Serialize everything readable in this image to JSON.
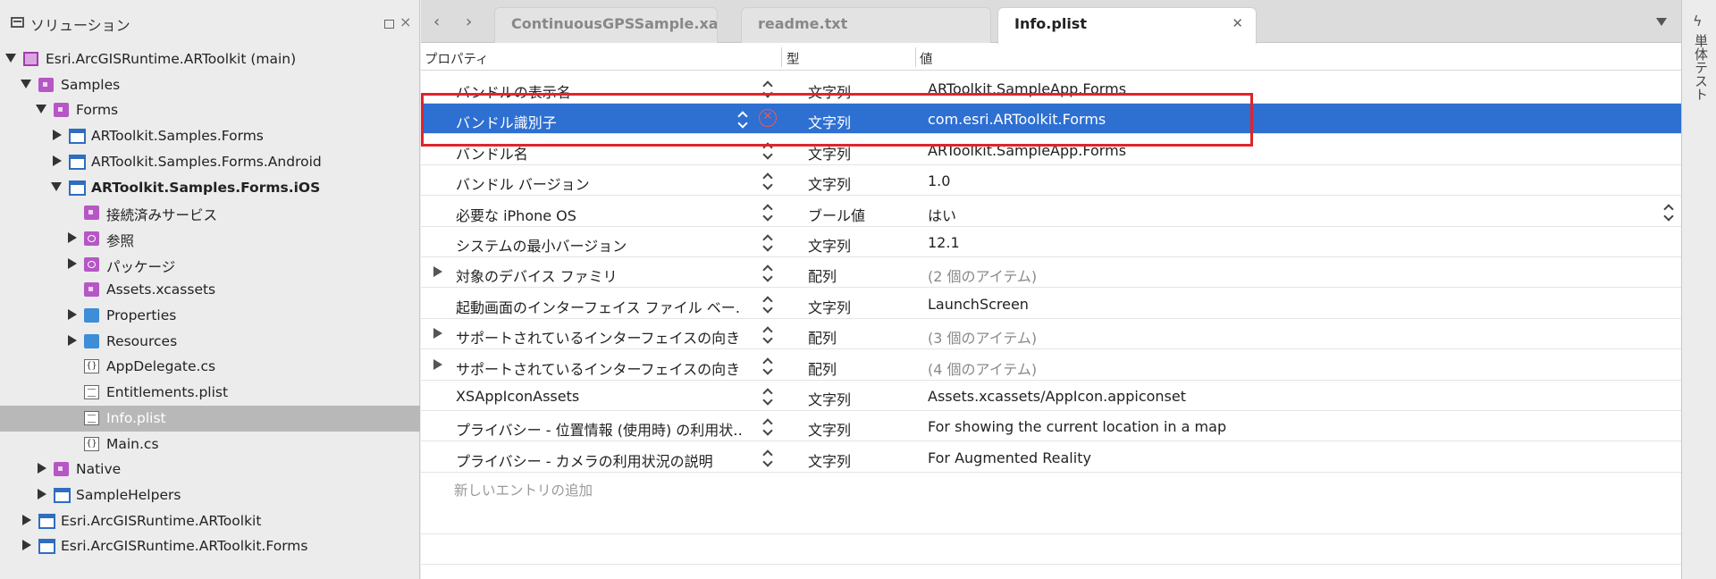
{
  "solution_pad": {
    "title": "ソリューション",
    "tree": [
      {
        "label": "Esri.ArcGISRuntime.ARToolkit (main)",
        "depth": 0,
        "arrow": "open",
        "icon": "solution-icon"
      },
      {
        "label": "Samples",
        "depth": 1,
        "arrow": "open",
        "icon": "folder-icon"
      },
      {
        "label": "Forms",
        "depth": 2,
        "arrow": "open",
        "icon": "folder-icon"
      },
      {
        "label": "ARToolkit.Samples.Forms",
        "depth": 3,
        "arrow": "closed",
        "icon": "project-icon"
      },
      {
        "label": "ARToolkit.Samples.Forms.Android",
        "depth": 3,
        "arrow": "closed",
        "icon": "project-icon"
      },
      {
        "label": "ARToolkit.Samples.Forms.iOS",
        "depth": 3,
        "arrow": "open",
        "icon": "project-icon",
        "bold": true
      },
      {
        "label": "接続済みサービス",
        "depth": 4,
        "arrow": "none",
        "icon": "connected-services-icon"
      },
      {
        "label": "参照",
        "depth": 4,
        "arrow": "closed",
        "icon": "references-icon"
      },
      {
        "label": "パッケージ",
        "depth": 4,
        "arrow": "closed",
        "icon": "packages-icon"
      },
      {
        "label": "Assets.xcassets",
        "depth": 4,
        "arrow": "none",
        "icon": "assets-icon"
      },
      {
        "label": "Properties",
        "depth": 4,
        "arrow": "closed",
        "icon": "blue-folder-icon"
      },
      {
        "label": "Resources",
        "depth": 4,
        "arrow": "closed",
        "icon": "blue-folder-icon"
      },
      {
        "label": "AppDelegate.cs",
        "depth": 4,
        "arrow": "none",
        "icon": "cs-file-icon"
      },
      {
        "label": "Entitlements.plist",
        "depth": 4,
        "arrow": "none",
        "icon": "plist-file-icon"
      },
      {
        "label": "Info.plist",
        "depth": 4,
        "arrow": "none",
        "icon": "plist-file-icon",
        "selected": true
      },
      {
        "label": "Main.cs",
        "depth": 4,
        "arrow": "none",
        "icon": "cs-file-icon"
      },
      {
        "label": "Native",
        "depth": 2,
        "arrow": "closed",
        "icon": "folder-icon"
      },
      {
        "label": "SampleHelpers",
        "depth": 2,
        "arrow": "closed",
        "icon": "project-icon"
      },
      {
        "label": "Esri.ArcGISRuntime.ARToolkit",
        "depth": 1,
        "arrow": "closed",
        "icon": "project-icon"
      },
      {
        "label": "Esri.ArcGISRuntime.ARToolkit.Forms",
        "depth": 1,
        "arrow": "closed",
        "icon": "project-icon"
      }
    ]
  },
  "tabs": [
    {
      "label": "ContinuousGPSSample.xaml.cs",
      "active": false
    },
    {
      "label": "readme.txt",
      "active": false
    },
    {
      "label": "Info.plist",
      "active": true
    }
  ],
  "columns": {
    "property": "プロパティ",
    "type": "型",
    "value": "値"
  },
  "rows": [
    {
      "prop": "バンドルの表示名",
      "type": "文字列",
      "value": "ARToolkit.SampleApp.Forms"
    },
    {
      "prop": "バンドル識別子",
      "type": "文字列",
      "value": "com.esri.ARToolkit.Forms",
      "selected": true
    },
    {
      "prop": "バンドル名",
      "type": "文字列",
      "value": "ARToolkit.SampleApp.Forms"
    },
    {
      "prop": "バンドル バージョン",
      "type": "文字列",
      "value": "1.0"
    },
    {
      "prop": "必要な iPhone OS",
      "type": "ブール値",
      "value": "はい",
      "value_stepper": true
    },
    {
      "prop": "システムの最小バージョン",
      "type": "文字列",
      "value": "12.1"
    },
    {
      "prop": "対象のデバイス ファミリ",
      "type": "配列",
      "value": "(2 個のアイテム)",
      "expandable": true,
      "dim": true
    },
    {
      "prop": "起動画面のインターフェイス ファイル ベー…",
      "type": "文字列",
      "value": "LaunchScreen"
    },
    {
      "prop": "サポートされているインターフェイスの向き",
      "type": "配列",
      "value": "(3 個のアイテム)",
      "expandable": true,
      "dim": true
    },
    {
      "prop": "サポートされているインターフェイスの向き…",
      "type": "配列",
      "value": "(4 個のアイテム)",
      "expandable": true,
      "dim": true
    },
    {
      "prop": "XSAppIconAssets",
      "type": "文字列",
      "value": "Assets.xcassets/AppIcon.appiconset"
    },
    {
      "prop": "プライバシー - 位置情報 (使用時) の利用状…",
      "type": "文字列",
      "value": "For showing the current location in a map"
    },
    {
      "prop": "プライバシー - カメラの利用状況の説明",
      "type": "文字列",
      "value": "For Augmented Reality"
    }
  ],
  "add_entry": "新しいエントリの追加",
  "right_strip": {
    "label": "単体テスト"
  },
  "colors": {
    "selection": "#2e6fd2",
    "highlight_box": "#e0242c",
    "remove_icon": "#e85a5a"
  }
}
